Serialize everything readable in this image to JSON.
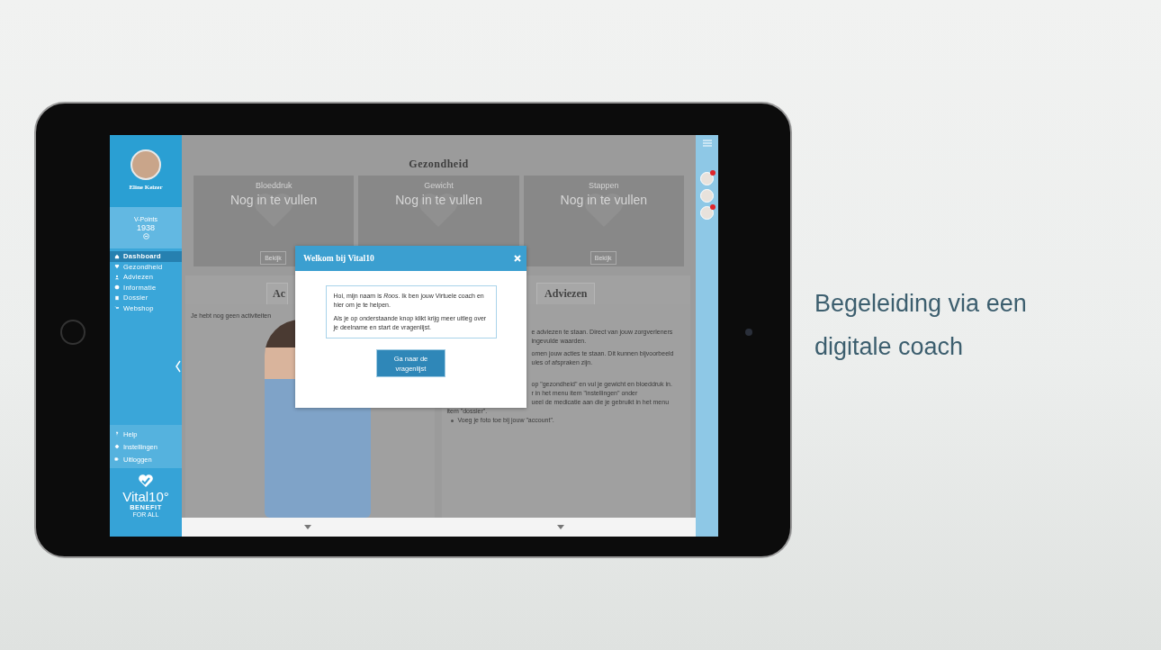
{
  "sidebar": {
    "user_name": "Eline Keizer",
    "points_label": "V-Points",
    "points_value": "1938",
    "menu": [
      {
        "label": "Dashboard",
        "selected": true
      },
      {
        "label": "Gezondheid",
        "selected": false
      },
      {
        "label": "Adviezen",
        "selected": false
      },
      {
        "label": "Informatie",
        "selected": false
      },
      {
        "label": "Dossier",
        "selected": false
      },
      {
        "label": "Webshop",
        "selected": false
      }
    ],
    "footer_menu": [
      {
        "label": "Help"
      },
      {
        "label": "Instellingen"
      },
      {
        "label": "Uitloggen"
      }
    ],
    "logo": {
      "name": "Vital10°",
      "tagline": "BENEFIT",
      "subline": "FOR ALL"
    }
  },
  "main": {
    "title": "Gezondheid",
    "cards": [
      {
        "label": "Bloeddruk",
        "value": "Nog in te vullen",
        "button": "Bekijk"
      },
      {
        "label": "Gewicht",
        "value": "Nog in te vullen"
      },
      {
        "label": "Stappen",
        "value": "Nog in te vullen",
        "button": "Bekijk"
      }
    ],
    "activities": {
      "tab": "Ac",
      "text": "Je hebt nog geen activiteiten"
    },
    "advice": {
      "tab": "Adviezen",
      "partial_lines": [
        "e adviezen te staan. Direct van jouw zorgverleners",
        "ingevulde waarden.",
        "omen jouw acties te staan. Dit kunnen bijvoorbeeld",
        "ules of afspraken zijn.",
        "op \"gezondheid\" en vul je gewicht en bloeddruk in.",
        "r in het menu item \"instellingen\" onder",
        "ueel de medicatie aan die je gebruikt in het menu"
      ],
      "line": "item \"dossier\".",
      "bullets": [
        "Voeg je foto toe bij jouw \"account\"."
      ]
    }
  },
  "modal": {
    "title": "Welkom bij Vital10",
    "paragraphs": [
      "Hoi, mijn naam is *Roos*. Ik ben jouw Virtuele coach en hier om je te helpen.",
      "Als je op onderstaande knop klikt krijg meer uitleg over je deelname en start de vragenlijst."
    ],
    "button": "Ga naar de vragenlijst"
  },
  "contacts": [
    {
      "badge": true
    },
    {
      "badge": false
    },
    {
      "badge": true
    }
  ],
  "caption": "Begeleiding via een digitale coach"
}
